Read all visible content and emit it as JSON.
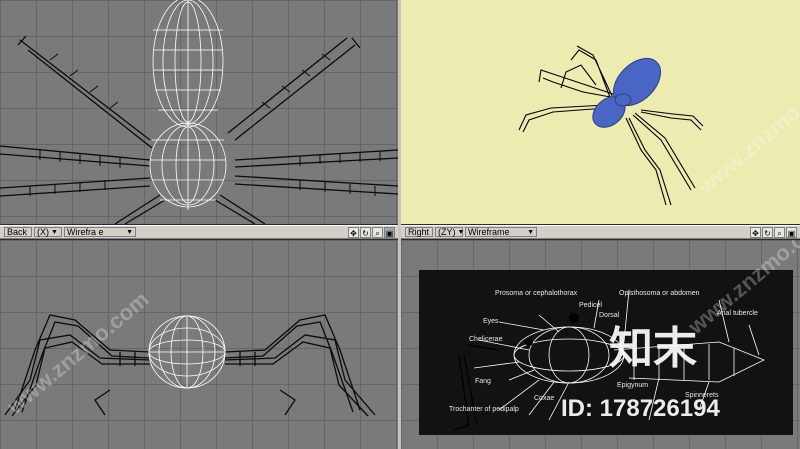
{
  "viewports": {
    "top_left": {
      "name": "Top wireframe viewport"
    },
    "top_right": {
      "name": "Perspective shaded viewport",
      "body_color": "#4a66c4",
      "background": "#ecebb0"
    },
    "bottom_left": {
      "name": "Back wireframe viewport"
    },
    "bottom_right": {
      "name": "Right wireframe viewport"
    }
  },
  "left_bar": {
    "view": "Back",
    "axis": "(X)",
    "mode": "Wirefra e"
  },
  "right_bar": {
    "view": "Right",
    "axis": "(ZY)",
    "mode": "Wireframe"
  },
  "tool_icons": [
    "move-icon",
    "rotate-icon",
    "zoom-icon",
    "maximize-icon"
  ],
  "anatomy_labels": {
    "l1": "Prosoma or cephalothorax",
    "l2": "Opisthosoma or abdomen",
    "l3": "Pedicel",
    "l4": "Anal tubercle",
    "l5": "Eyes",
    "l6": "Chelicerae",
    "l7": "Fang",
    "l8": "Trochanter of pedipalp",
    "l9": "Coxae",
    "l10": "Spinnerets",
    "l11": "Dorsal",
    "l12": "Epigynum"
  },
  "watermark": {
    "brand": "知末",
    "id_text": "ID: 178726194",
    "diag_text": "www.znzmo.com"
  }
}
